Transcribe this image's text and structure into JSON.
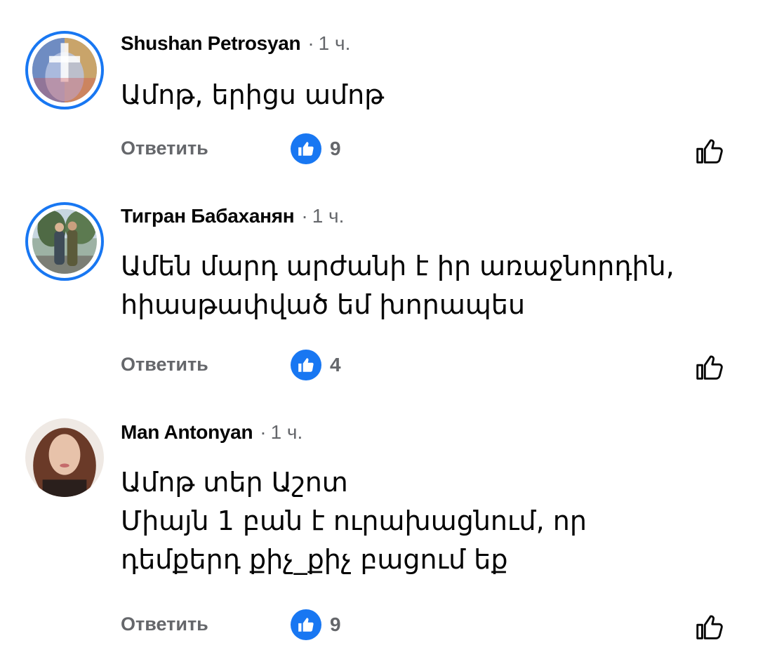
{
  "comments": [
    {
      "author": "Shushan Petrosyan",
      "time": "1 ч.",
      "text": "Ամոթ, երիցս ամոթ",
      "reply_label": "Ответить",
      "reactions": 9,
      "reaction_icon": "thumbs-up-icon",
      "avatar_ring": true
    },
    {
      "author": "Тигран Бабаханян",
      "time": "1 ч.",
      "text": "Ամեն մարդ արժանի է իր առաջնորդին,\nհիասթափված եմ խորապես",
      "reply_label": "Ответить",
      "reactions": 4,
      "reaction_icon": "thumbs-up-icon",
      "avatar_ring": true
    },
    {
      "author": "Man Antonyan",
      "time": "1 ч.",
      "text": "Ամոթ տեր Աշոտ\nՄիայն 1 բան է ուրախացնում, որ\nդեմքերդ քիչ_քիչ բացում եք",
      "reply_label": "Ответить",
      "reactions": 9,
      "reaction_icon": "thumbs-up-icon",
      "avatar_ring": false
    }
  ],
  "colors": {
    "accent": "#1877f2",
    "secondary_text": "#65676b",
    "primary_text": "#050505"
  }
}
